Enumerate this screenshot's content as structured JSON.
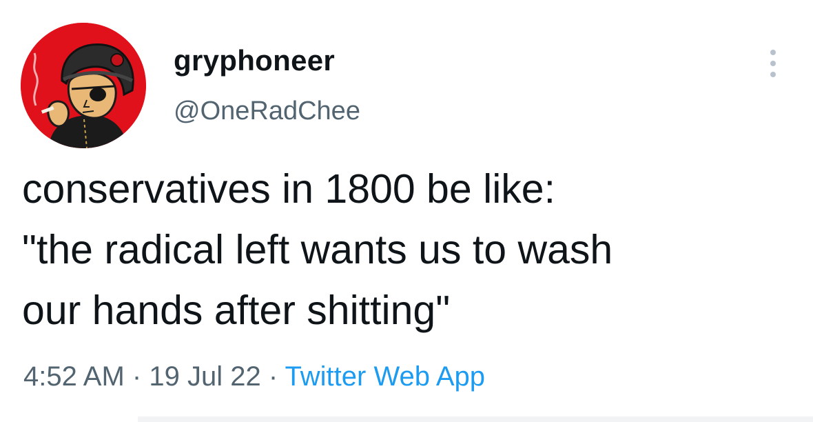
{
  "author": {
    "display_name": "gryphoneer",
    "handle": "@OneRadChee",
    "avatar_icon": "avatar-image",
    "avatar_bg": "#e0111b"
  },
  "tweet": {
    "text_lines": [
      "conservatives in 1800 be like:",
      "\"the radical left wants us to wash",
      "our hands after shitting\""
    ]
  },
  "meta": {
    "time": "4:52 AM",
    "separator": "·",
    "date": "19 Jul 22",
    "source": "Twitter Web App"
  },
  "icons": {
    "more": "more-options-icon"
  },
  "colors": {
    "text": "#0f1419",
    "secondary": "#536471",
    "link": "#1d9bf0"
  }
}
